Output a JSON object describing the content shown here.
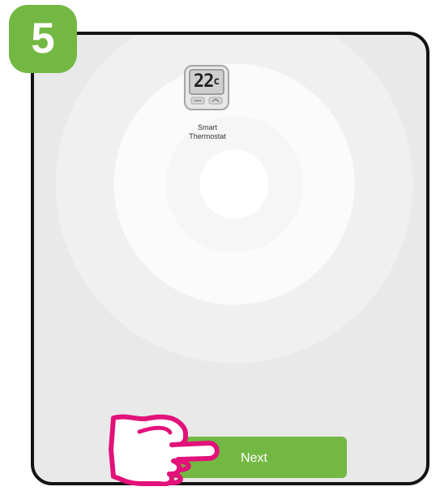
{
  "step": {
    "number": "5"
  },
  "device": {
    "display_temperature": "22",
    "display_unit": "c",
    "label": "Smart\nThermostat",
    "icon": "thermostat-icon"
  },
  "actions": {
    "next_label": "Next"
  },
  "icons": {
    "pointer": "pointing-hand-icon"
  },
  "colors": {
    "accent": "#73b843",
    "hand_outline": "#e2127a",
    "frame": "#141414"
  }
}
